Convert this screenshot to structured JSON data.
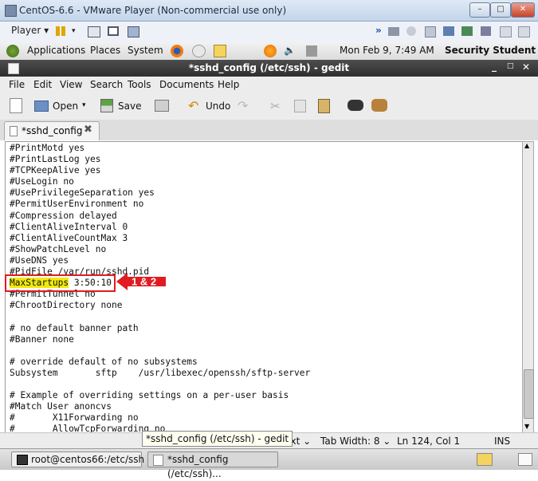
{
  "vm_window": {
    "title": "CentOS-6.6 - VMware Player (Non-commercial use only)"
  },
  "vm_toolbar": {
    "player_label": "Player"
  },
  "gnome_panel": {
    "menus": [
      "Applications",
      "Places",
      "System"
    ],
    "clock": "Mon Feb  9,  7:49 AM",
    "user": "Security Student"
  },
  "gedit": {
    "window_title": "*sshd_config (/etc/ssh) - gedit",
    "menu": [
      "File",
      "Edit",
      "View",
      "Search",
      "Tools",
      "Documents",
      "Help"
    ],
    "toolbar": {
      "open": "Open",
      "save": "Save",
      "undo": "Undo"
    },
    "tab_label": "*sshd_config",
    "lines": [
      "#PrintMotd yes",
      "#PrintLastLog yes",
      "#TCPKeepAlive yes",
      "#UseLogin no",
      "#UsePrivilegeSeparation yes",
      "#PermitUserEnvironment no",
      "#Compression delayed",
      "#ClientAliveInterval 0",
      "#ClientAliveCountMax 3",
      "#ShowPatchLevel no",
      "#UseDNS yes",
      "#PidFile /var/run/sshd.pid",
      "",
      "#PermitTunnel no",
      "#ChrootDirectory none",
      "",
      "# no default banner path",
      "#Banner none",
      "",
      "# override default of no subsystems",
      "Subsystem       sftp    /usr/libexec/openssh/sftp-server",
      "",
      "# Example of overriding settings on a per-user basis",
      "#Match User anoncvs",
      "#       X11Forwarding no",
      "#       AllowTcpForwarding no"
    ],
    "highlight_line": {
      "keyword": "MaxStartups",
      "rest": " 3:50:10"
    },
    "annotation": "1 & 2",
    "statusbar": {
      "lang": "Text",
      "tab_width": "Tab Width:  8",
      "position": "Ln 124, Col 1",
      "mode": "INS"
    },
    "tooltip": "*sshd_config (/etc/ssh) - gedit"
  },
  "taskbar": {
    "items": [
      "root@centos66:/etc/ssh",
      "*sshd_config (/etc/ssh)..."
    ]
  },
  "colors": {
    "highlight": "#f2e90d",
    "annotation": "#e01b22"
  }
}
